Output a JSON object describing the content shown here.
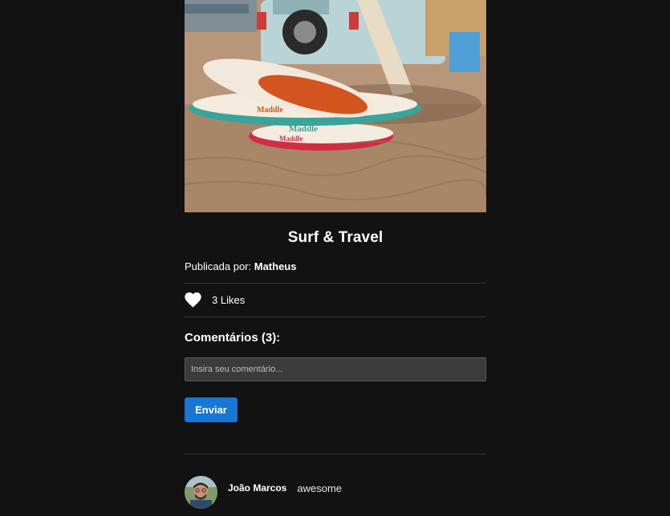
{
  "post": {
    "title": "Surf & Travel",
    "author_prefix": "Publicada por:",
    "author_name": "Matheus",
    "likes_label": "3 Likes",
    "image_icon": "surfboards-van-photo"
  },
  "comments_section": {
    "title": "Comentários (3):",
    "input_placeholder": "Insira seu comentário...",
    "input_value": "",
    "send_label": "Enviar"
  },
  "comments": [
    {
      "author": "João Marcos",
      "text": "awesome"
    }
  ],
  "colors": {
    "background": "#121212",
    "accent": "#1976d2",
    "input_bg": "#3b3b3b",
    "divider": "#333333"
  }
}
